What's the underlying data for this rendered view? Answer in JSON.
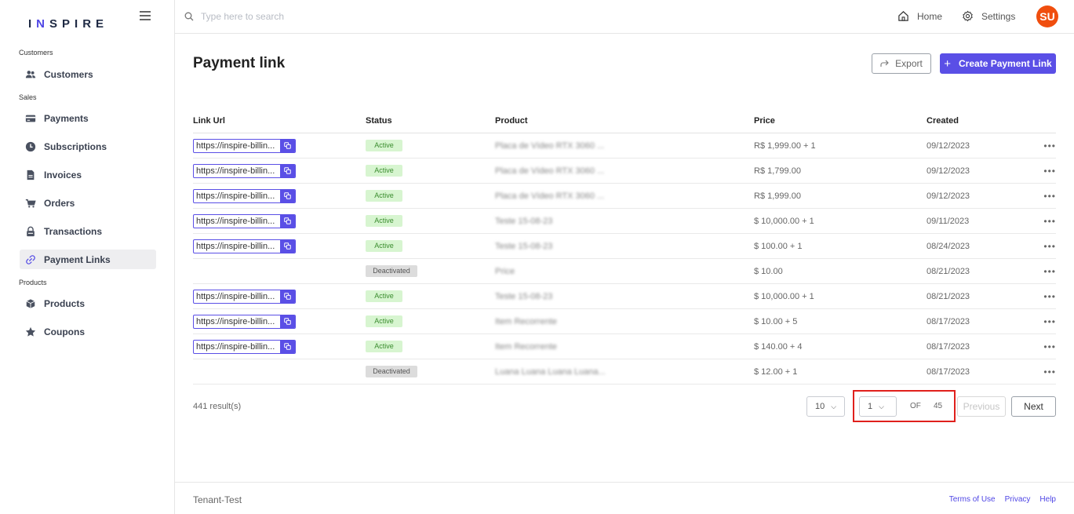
{
  "brand": {
    "prefix": "I",
    "accent": "N",
    "suffix": "SPIRE"
  },
  "sidebar": {
    "sections": [
      {
        "label": "Customers"
      },
      {
        "label": "Sales"
      },
      {
        "label": "Products"
      }
    ],
    "items": [
      {
        "label": "Customers",
        "icon": "users-icon"
      },
      {
        "label": "Payments",
        "icon": "credit-card-icon"
      },
      {
        "label": "Subscriptions",
        "icon": "clock-icon"
      },
      {
        "label": "Invoices",
        "icon": "document-icon"
      },
      {
        "label": "Orders",
        "icon": "cart-icon"
      },
      {
        "label": "Transactions",
        "icon": "lock-icon"
      },
      {
        "label": "Payment Links",
        "icon": "link-icon",
        "active": true
      },
      {
        "label": "Products",
        "icon": "box-icon"
      },
      {
        "label": "Coupons",
        "icon": "star-icon"
      }
    ]
  },
  "topbar": {
    "search_placeholder": "Type here to search",
    "home_label": "Home",
    "settings_label": "Settings",
    "avatar_initials": "SU"
  },
  "page": {
    "title": "Payment link",
    "export_label": "Export",
    "create_label": "Create Payment Link"
  },
  "table": {
    "headers": {
      "url": "Link Url",
      "status": "Status",
      "product": "Product",
      "price": "Price",
      "created": "Created"
    },
    "rows": [
      {
        "url": "https://inspire-billin...",
        "status": "Active",
        "product": "Placa de Vídeo RTX 3060 ...",
        "price": "R$ 1,999.00 + 1",
        "created": "09/12/2023"
      },
      {
        "url": "https://inspire-billin...",
        "status": "Active",
        "product": "Placa de Vídeo RTX 3060 ...",
        "price": "R$ 1,799.00",
        "created": "09/12/2023"
      },
      {
        "url": "https://inspire-billin...",
        "status": "Active",
        "product": "Placa de Vídeo RTX 3060 ...",
        "price": "R$ 1,999.00",
        "created": "09/12/2023"
      },
      {
        "url": "https://inspire-billin...",
        "status": "Active",
        "product": "Teste 15-08-23",
        "price": "$ 10,000.00 + 1",
        "created": "09/11/2023"
      },
      {
        "url": "https://inspire-billin...",
        "status": "Active",
        "product": "Teste 15-08-23",
        "price": "$ 100.00 + 1",
        "created": "08/24/2023"
      },
      {
        "url": "",
        "status": "Deactivated",
        "product": "Price",
        "price": "$ 10.00",
        "created": "08/21/2023"
      },
      {
        "url": "https://inspire-billin...",
        "status": "Active",
        "product": "Teste 15-08-23",
        "price": "$ 10,000.00 + 1",
        "created": "08/21/2023"
      },
      {
        "url": "https://inspire-billin...",
        "status": "Active",
        "product": "Item Recorrente",
        "price": "$ 10.00 + 5",
        "created": "08/17/2023"
      },
      {
        "url": "https://inspire-billin...",
        "status": "Active",
        "product": "Item Recorrente",
        "price": "$ 140.00 + 4",
        "created": "08/17/2023"
      },
      {
        "url": "",
        "status": "Deactivated",
        "product": "Luana Luana Luana Luana...",
        "price": "$ 12.00 + 1",
        "created": "08/17/2023"
      }
    ],
    "row_menu": "•••"
  },
  "pagination": {
    "results": "441 result(s)",
    "page_size": "10",
    "current_page": "1",
    "of_label": "OF",
    "total_pages": "45",
    "previous_label": "Previous",
    "next_label": "Next"
  },
  "footer": {
    "tenant": "Tenant-Test",
    "links": [
      "Terms of Use",
      "Privacy",
      "Help"
    ]
  },
  "colors": {
    "accent": "#5a4fe6",
    "avatar": "#f04e0e",
    "active_badge": "#d7f5d0",
    "highlight": "#e0201c"
  }
}
